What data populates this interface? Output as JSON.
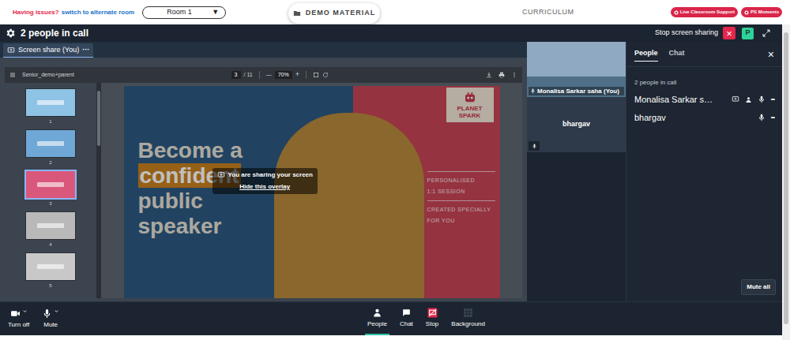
{
  "topbar": {
    "issue": "Having issues?",
    "switch_link": "switch to alternate room",
    "room": {
      "label": "Room 1",
      "caret": "▼"
    },
    "demo_material": "DEMO MATERIAL",
    "curriculum": "CURRICULUM",
    "buttons": [
      "Live Classroom Support",
      "PS Moments"
    ]
  },
  "call": {
    "title": "2 people in call",
    "stop_sharing": "Stop screen sharing",
    "stop_icon": "×",
    "avatar": "P"
  },
  "share_tab": {
    "label": "Screen share (You)",
    "more": "···",
    "selected": true
  },
  "viewer": {
    "filename": "Senior_demo+parent",
    "page": "3",
    "pages": "/ 11",
    "zoom_out": "—",
    "zoom": "70%",
    "zoom_in": "+",
    "thumbnails": [
      {
        "number": "1",
        "selected": false,
        "color": "#8fc3e6"
      },
      {
        "number": "2",
        "selected": false,
        "color": "#6fa8d6"
      },
      {
        "number": "3",
        "selected": true,
        "color": "#d9577a"
      },
      {
        "number": "4",
        "selected": false,
        "color": "#b9b9b9"
      },
      {
        "number": "5",
        "selected": false,
        "color": "#c8c8c8"
      }
    ],
    "slide": {
      "headline": [
        {
          "text": "Become a",
          "highlighted": false
        },
        {
          "text": "confident",
          "highlighted": true
        },
        {
          "text": "public",
          "highlighted": false
        },
        {
          "text": "speaker",
          "highlighted": false
        }
      ],
      "brand": [
        "PLANET",
        "SPARK"
      ],
      "taglines": [
        "PERSONALISED",
        "1:1 SESSION",
        "CREATED SPECIALLY",
        "FOR YOU"
      ]
    },
    "overlay": {
      "text": "You are sharing your screen",
      "link": "Hide this overlay"
    }
  },
  "tiles": [
    {
      "name": "Monalisa Sarkar saha (You)",
      "kind": "video",
      "muted": false
    },
    {
      "name": "bhargav",
      "kind": "avatar",
      "muted": false
    }
  ],
  "panel": {
    "tabs": [
      {
        "label": "People",
        "selected": true
      },
      {
        "label": "Chat",
        "selected": false
      }
    ],
    "close": "×",
    "count": "2 people in call",
    "people": [
      {
        "name": "Monalisa Sarkar s…",
        "presenting": true,
        "muted": false,
        "more": "•••"
      },
      {
        "name": "bhargav",
        "presenting": false,
        "muted": false,
        "more": "•••"
      }
    ],
    "mute_all": "Mute all"
  },
  "controls": {
    "left": [
      {
        "label": "Turn off",
        "kind": "camera"
      },
      {
        "label": "Mute",
        "kind": "mic"
      }
    ],
    "center": [
      {
        "label": "People",
        "kind": "people",
        "selected": true
      },
      {
        "label": "Chat",
        "kind": "chat",
        "selected": false
      },
      {
        "label": "Stop",
        "kind": "stop",
        "selected": false
      },
      {
        "label": "Background",
        "kind": "background",
        "selected": false
      }
    ]
  }
}
